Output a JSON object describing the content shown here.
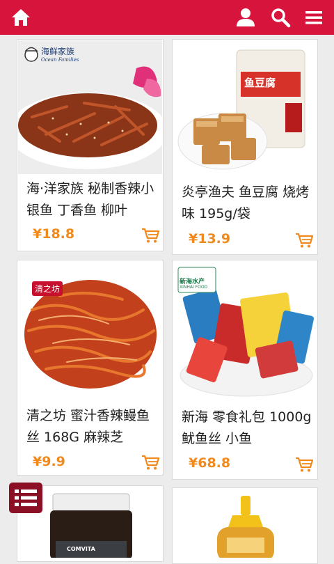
{
  "header": {
    "home_icon": "home-icon",
    "user_icon": "user-icon",
    "search_icon": "search-icon",
    "menu_icon": "menu-icon",
    "accent_color": "#d7143c"
  },
  "products": [
    {
      "title": "海·洋家族 秘制香辣小银鱼 丁香鱼 柳叶",
      "price": "¥18.8",
      "brand_mark": "海鲜家族",
      "brand_mark_sub": "Ocean Families"
    },
    {
      "title": "炎亭渔夫 鱼豆腐 烧烤味 195g/袋",
      "price": "¥13.9",
      "brand_mark": "鱼豆腐"
    },
    {
      "title": "清之坊 蜜汁香辣鳗鱼丝 168G 麻辣芝",
      "price": "¥9.9",
      "brand_mark": "清之坊"
    },
    {
      "title": "新海 零食礼包 1000g 鱿鱼丝 小鱼",
      "price": "¥68.8",
      "brand_mark": "新海水产",
      "brand_mark_sub": "XINHAI FOOD"
    },
    {
      "title": "",
      "price": "",
      "brand_mark": "COMVITA"
    },
    {
      "title": "",
      "price": ""
    }
  ],
  "cart_icon": "cart-icon",
  "fab_icon": "list-icon",
  "price_color": "#f08a1e"
}
